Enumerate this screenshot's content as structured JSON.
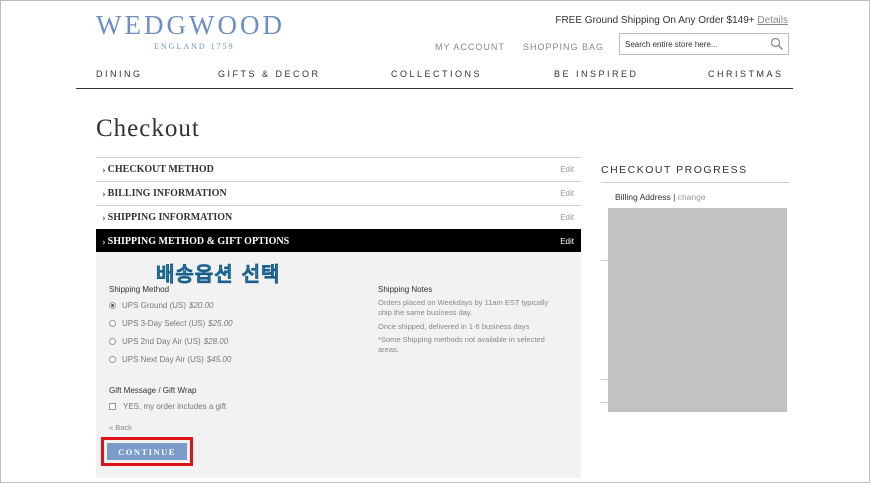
{
  "header": {
    "brand": "WEDGWOOD",
    "brand_sub": "ENGLAND 1759",
    "promo_text": "FREE Ground Shipping On Any Order $149+",
    "promo_link": "Details",
    "my_account": "MY ACCOUNT",
    "shopping_bag": "SHOPPING BAG",
    "search_placeholder": "Search entire store here..."
  },
  "nav": [
    "DINING",
    "GIFTS & DECOR",
    "COLLECTIONS",
    "BE INSPIRED",
    "CHRISTMAS"
  ],
  "page_title": "Checkout",
  "steps": [
    {
      "label": "CHECKOUT METHOD",
      "edit": "Edit"
    },
    {
      "label": "BILLING INFORMATION",
      "edit": "Edit"
    },
    {
      "label": "SHIPPING INFORMATION",
      "edit": "Edit"
    },
    {
      "label": "SHIPPING METHOD & GIFT OPTIONS",
      "edit": "Edit"
    }
  ],
  "annotation": "배송옵션 선택",
  "shipping": {
    "method_label": "Shipping Method",
    "options": [
      {
        "name": "UPS Ground (US)",
        "price": "$20.00",
        "selected": true
      },
      {
        "name": "UPS 3-Day Select (US)",
        "price": "$25.00",
        "selected": false
      },
      {
        "name": "UPS 2nd Day Air (US)",
        "price": "$28.00",
        "selected": false
      },
      {
        "name": "UPS Next Day Air (US)",
        "price": "$45.00",
        "selected": false
      }
    ],
    "notes_label": "Shipping Notes",
    "notes": [
      "Orders placed on Weekdays by 11am EST typically ship the same business day.",
      "Once shipped, delivered in 1-6 business days",
      "*Some Shipping methods not available in selected areas."
    ],
    "gift_label": "Gift Message / Gift Wrap",
    "gift_option": "YES, my order includes a gift",
    "back": "« Back",
    "continue": "CONTINUE"
  },
  "progress": {
    "title": "CHECKOUT PROGRESS",
    "item": "Billing Address",
    "sep": " | ",
    "change": "change"
  },
  "colors": {
    "brand_blue": "#6f8fc3",
    "continue_button": "#7a9ccb",
    "highlight_red": "#e0131a",
    "annotation_cyan": "#45b4d8"
  }
}
